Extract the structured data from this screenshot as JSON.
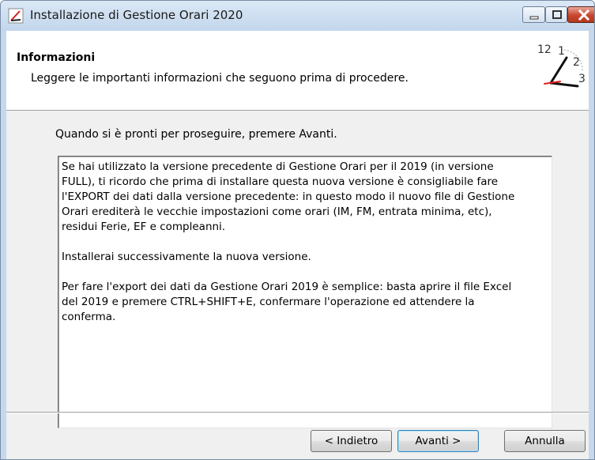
{
  "window": {
    "title": "Installazione di Gestione Orari 2020"
  },
  "header": {
    "title": "Informazioni",
    "subtitle": "Leggere le importanti informazioni che seguono prima di procedere.",
    "clock_digits": {
      "twelve": "12",
      "one": "1",
      "two": "2",
      "three": "3"
    }
  },
  "main": {
    "prompt": "Quando si è pronti per proseguire, premere Avanti.",
    "info_paragraphs": [
      "Se hai utilizzato la versione precedente di Gestione Orari per il 2019 (in versione\nFULL), ti ricordo che prima di installare questa nuova versione è consigliabile fare\nl'EXPORT dei dati dalla versione precedente: in questo modo il nuovo file di Gestione\nOrari erediterà le vecchie impostazioni come orari (IM, FM, entrata minima, etc),\nresidui Ferie, EF e compleanni.",
      "Installerai successivamente la nuova versione.",
      "Per fare l'export dei dati da Gestione Orari 2019 è semplice: basta aprire il file Excel\ndel 2019 e premere CTRL+SHIFT+E, confermare l'operazione ed attendere la\nconferma."
    ]
  },
  "buttons": {
    "back": "< Indietro",
    "next": "Avanti >",
    "cancel": "Annulla"
  },
  "icons": {
    "app": "clock-setup-icon",
    "minimize": "minimize-icon",
    "maximize": "maximize-icon",
    "close": "close-icon",
    "header": "clock-icon"
  },
  "colors": {
    "close_button": "#c8452d",
    "clock_hand": "#e02020"
  }
}
